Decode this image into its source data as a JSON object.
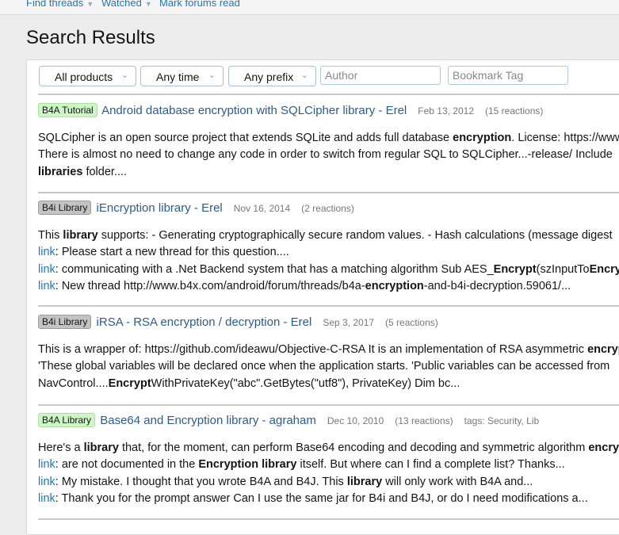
{
  "nav": {
    "find_threads": "Find threads",
    "watched": "Watched",
    "mark_read": "Mark forums read"
  },
  "page_title": "Search Results",
  "filters": {
    "products": "All products",
    "time": "Any time",
    "prefix": "Any prefix",
    "author_placeholder": "Author",
    "bookmark_placeholder": "Bookmark Tag"
  },
  "colors": {
    "link": "#2577b1",
    "title": "#2c5b8e",
    "badge_green": "#cdf5c5",
    "badge_grey": "#c3c3c3"
  },
  "results": [
    {
      "badge": "B4A Tutorial",
      "badge_style": "green",
      "title": "Android database encryption with SQLCipher library - Erel",
      "date": "Feb 13, 2012",
      "reactions": "(15 reactions)",
      "tags": "",
      "lines": [
        {
          "link": "",
          "segs": [
            [
              "SQLCipher is an open source project that extends SQLite and adds full database ",
              0
            ],
            [
              "encryption",
              1
            ],
            [
              ". License: https://www.zetetic.net/sqlcipher/license/",
              0
            ]
          ]
        },
        {
          "link": "",
          "segs": [
            [
              "There is almost no need to change any code in order to switch from regular SQL to SQLCipher...-release/ Include",
              0
            ]
          ]
        },
        {
          "link": "",
          "segs": [
            [
              "libraries",
              1
            ],
            [
              " folder....",
              0
            ]
          ]
        }
      ]
    },
    {
      "badge": "B4i Library",
      "badge_style": "grey",
      "title": "iEncryption library - Erel",
      "date": "Nov 16, 2014",
      "reactions": "(2 reactions)",
      "tags": "",
      "lines": [
        {
          "link": "",
          "segs": [
            [
              "This ",
              0
            ],
            [
              "library",
              1
            ],
            [
              " supports: - Generating cryptographically secure random values. - Hash calculations (message digest",
              0
            ]
          ]
        },
        {
          "link": "link",
          "segs": [
            [
              ": Please start a new thread for this question....",
              0
            ]
          ]
        },
        {
          "link": "link",
          "segs": [
            [
              ": communicating with a .Net Backend system that has a matching algorithm Sub AES_",
              0
            ],
            [
              "Encrypt",
              1
            ],
            [
              "(szInputTo",
              0
            ],
            [
              "Encrypt",
              1
            ]
          ]
        },
        {
          "link": "link",
          "segs": [
            [
              ": New thread http://www.b4x.com/android/forum/threads/b4a-",
              0
            ],
            [
              "encryption",
              1
            ],
            [
              "-and-b4i-decryption.59061/...",
              0
            ]
          ]
        }
      ]
    },
    {
      "badge": "B4i Library",
      "badge_style": "grey",
      "title": "iRSA - RSA encryption / decryption - Erel",
      "date": "Sep 3, 2017",
      "reactions": "(5 reactions)",
      "tags": "",
      "lines": [
        {
          "link": "",
          "segs": [
            [
              "This is a wrapper of: https://github.com/ideawu/Objective-C-RSA It is an implementation of RSA asymmetric ",
              0
            ],
            [
              "encryption",
              1
            ]
          ]
        },
        {
          "link": "",
          "segs": [
            [
              "'These global variables will be declared once when the application starts. 'Public variables can be accessed from",
              0
            ]
          ]
        },
        {
          "link": "",
          "segs": [
            [
              "NavControl....",
              0
            ],
            [
              "Encrypt",
              1
            ],
            [
              "WithPrivateKey(\"abc\".GetBytes(\"utf8\"), PrivateKey) Dim bc...",
              0
            ]
          ]
        }
      ]
    },
    {
      "badge": "B4A Library",
      "badge_style": "green",
      "title": "Base64 and Encryption library - agraham",
      "date": "Dec 10, 2010",
      "reactions": "(13 reactions)",
      "tags": "tags: Security, Lib",
      "lines": [
        {
          "link": "",
          "segs": [
            [
              "Here's a ",
              0
            ],
            [
              "library",
              1
            ],
            [
              " that, for the moment, can perform Base64 encoding and decoding and symmetric algorithm ",
              0
            ],
            [
              "encryption",
              1
            ]
          ]
        },
        {
          "link": "link",
          "segs": [
            [
              ": are not documented in the ",
              0
            ],
            [
              "Encryption library",
              1
            ],
            [
              " itself. But where can I find a complete list? Thanks...",
              0
            ]
          ]
        },
        {
          "link": "link",
          "segs": [
            [
              ": My mistake. I thought that you wrote B4A and B4J. This ",
              0
            ],
            [
              "library",
              1
            ],
            [
              " will only work with B4A and...",
              0
            ]
          ]
        },
        {
          "link": "link",
          "segs": [
            [
              ": Thank you for the prompt answer Can I use the same jar for B4i and B4J, or do I need modifications a...",
              0
            ]
          ]
        }
      ]
    }
  ]
}
